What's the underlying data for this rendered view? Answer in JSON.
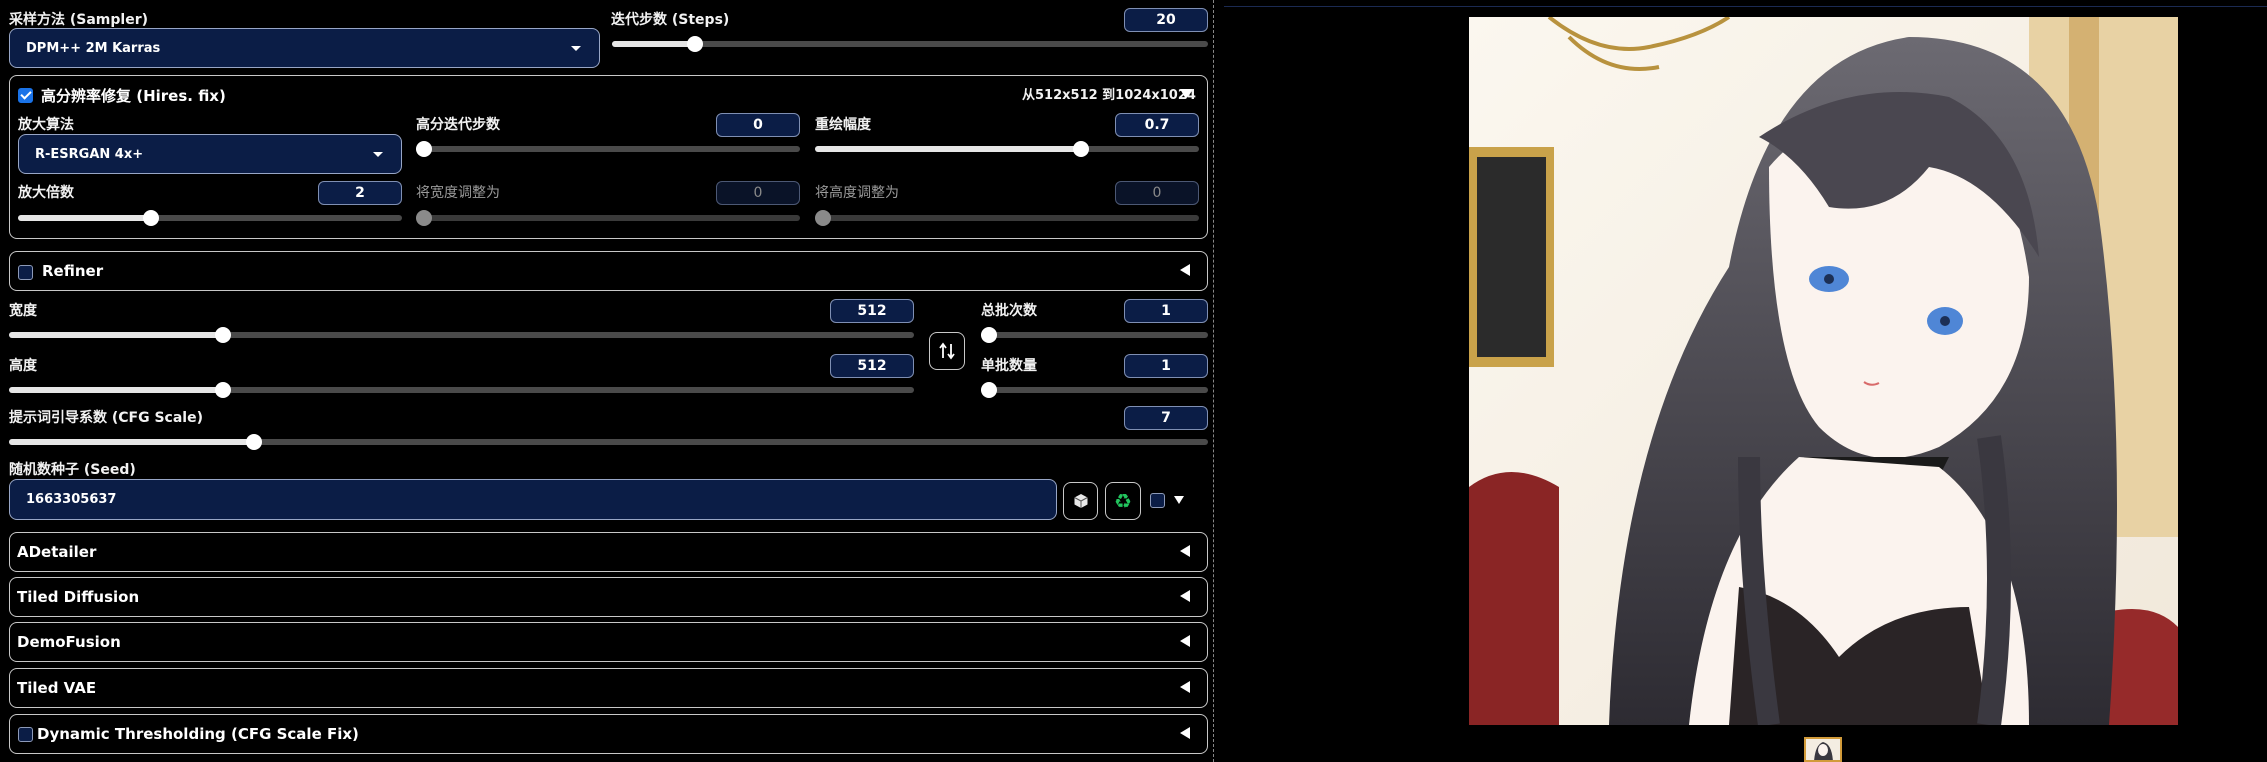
{
  "sampler": {
    "label": "采样方法 (Sampler)",
    "value": "DPM++ 2M Karras"
  },
  "steps": {
    "label": "迭代步数 (Steps)",
    "value": "20",
    "fraction": 0.13
  },
  "hires": {
    "checked": true,
    "title": "高分辨率修复 (Hires. fix)",
    "summary": "从512x512 到1024x1024",
    "upscaler": {
      "label": "放大算法",
      "value": "R-ESRGAN 4x+"
    },
    "hires_steps": {
      "label": "高分迭代步数",
      "value": "0",
      "fraction": 0.0
    },
    "denoise": {
      "label": "重绘幅度",
      "value": "0.7",
      "fraction": 0.7
    },
    "upscale_by": {
      "label": "放大倍数",
      "value": "2",
      "fraction": 0.34
    },
    "resize_width": {
      "label": "将宽度调整为",
      "value": "0",
      "fraction": 0.0
    },
    "resize_height": {
      "label": "将高度调整为",
      "value": "0",
      "fraction": 0.0
    }
  },
  "refiner": {
    "checked": false,
    "title": "Refiner"
  },
  "width": {
    "label": "宽度",
    "value": "512",
    "fraction": 0.232
  },
  "height": {
    "label": "高度",
    "value": "512",
    "fraction": 0.232
  },
  "swap_icon": "swap-vertical-icon",
  "batch_count": {
    "label": "总批次数",
    "value": "1",
    "fraction": 0.0
  },
  "batch_size": {
    "label": "单批数量",
    "value": "1",
    "fraction": 0.0
  },
  "cfg": {
    "label": "提示词引导系数 (CFG Scale)",
    "value": "7",
    "fraction": 0.2
  },
  "seed": {
    "label": "随机数种子 (Seed)",
    "value": "1663305637",
    "random_icon": "dice-icon",
    "reuse_icon": "recycle-icon",
    "extra_checked": false
  },
  "accordions": [
    {
      "title": "ADetailer",
      "checkbox": false
    },
    {
      "title": "Tiled Diffusion",
      "checkbox": false
    },
    {
      "title": "DemoFusion",
      "checkbox": false
    },
    {
      "title": "Tiled VAE",
      "checkbox": false
    },
    {
      "title": "Dynamic Thresholding (CFG Scale Fix)",
      "checkbox": true
    }
  ],
  "colors": {
    "accent": "#1a73e8",
    "input_bg": "#0b1d46",
    "recycle": "#22c55e"
  }
}
